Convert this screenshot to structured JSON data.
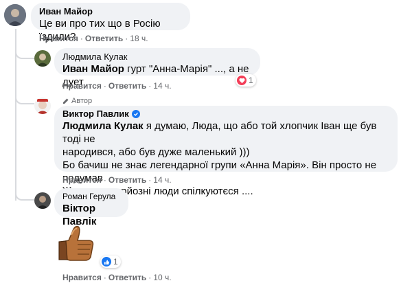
{
  "comments": [
    {
      "author": "Иван Майор",
      "text": "Це ви про тих що в Росію їздили?",
      "actions": {
        "like": "Нравится",
        "reply": "Ответить",
        "time": "18 ч."
      }
    },
    {
      "author": "Людмила Кулак",
      "mention": "Иван Майор",
      "text": " гурт \"Анна-Марія\" ..., а не дует",
      "reaction": {
        "icon": "heart-icon",
        "count": "1",
        "color": "#f33e58"
      },
      "actions": {
        "like": "Нравится",
        "reply": "Ответить",
        "time": "14 ч."
      }
    },
    {
      "badge": "Автор",
      "author": "Виктор Павлик",
      "verified_icon": "verified-badge-icon",
      "mention": "Людмила Кулак",
      "text_line1": " я думаю, Люда, що або той хлопчик Іван ще був тоді не",
      "text_line2": "народився, або був дуже маленький )))",
      "text_line3": "Бо бачиш не знає легендарної групи «Анна Марія». Він просто не подумав",
      "text_line4": "))) що тут серйозні люди спілкуютєся ....",
      "actions": {
        "like": "Нравится",
        "reply": "Ответить",
        "time": "14 ч."
      }
    },
    {
      "author": "Роман Герула",
      "mention": "Віктор Павлік",
      "sticker": "thumbs-up-sticker",
      "reaction": {
        "icon": "like-icon",
        "count": "1",
        "color": "#1877f2"
      },
      "actions": {
        "like": "Нравится",
        "reply": "Ответить",
        "time": "10 ч."
      }
    }
  ],
  "colors": {
    "bubble": "#f0f2f5",
    "meta": "#65676b",
    "verified": "#1877f2"
  }
}
